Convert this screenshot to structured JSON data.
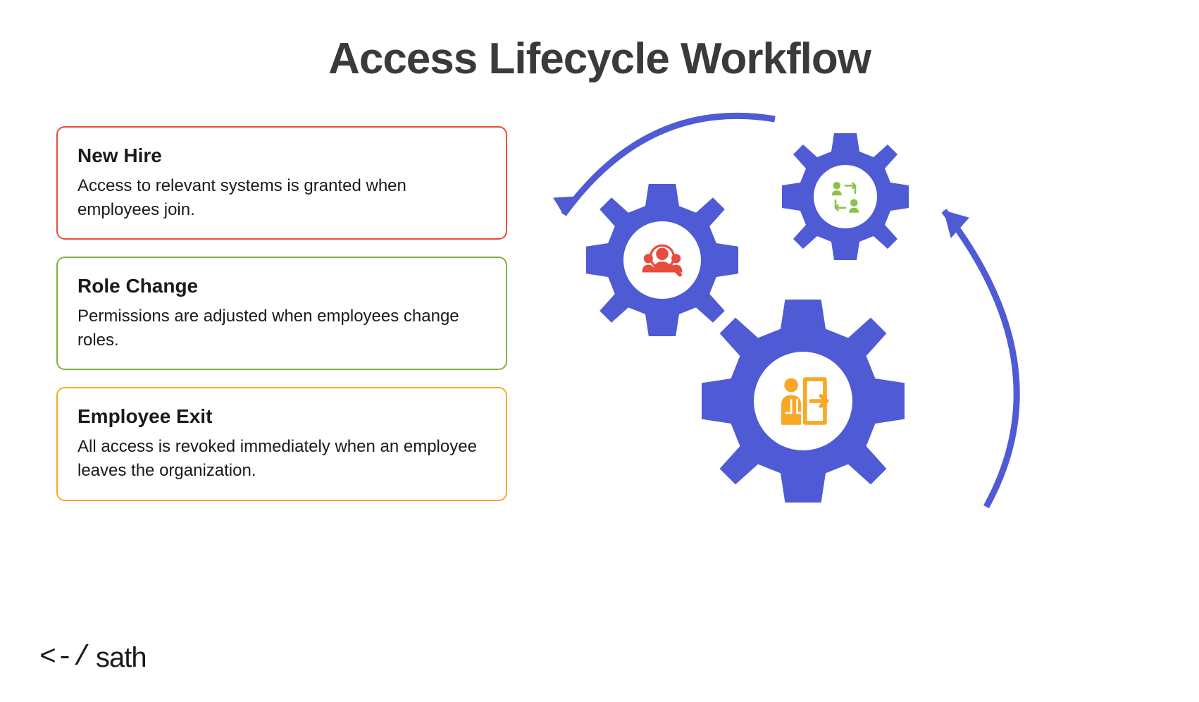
{
  "title": "Access Lifecycle Workflow",
  "cards": [
    {
      "title": "New Hire",
      "desc": "Access to relevant systems is granted when employees join.",
      "color": "#e94b3c"
    },
    {
      "title": "Role Change",
      "desc": "Permissions are adjusted when employees change roles.",
      "color": "#7cb342"
    },
    {
      "title": "Employee Exit",
      "desc": "All access is revoked immediately when an employee leaves the organization.",
      "color": "#f9a825"
    }
  ],
  "gears": [
    {
      "name": "new-hire-gear",
      "icon": "people-search-icon",
      "icon_color": "#e94b3c"
    },
    {
      "name": "role-change-gear",
      "icon": "people-swap-icon",
      "icon_color": "#7cb342"
    },
    {
      "name": "employee-exit-gear",
      "icon": "person-exit-icon",
      "icon_color": "#f9a825"
    }
  ],
  "gear_color": "#4f5bd5",
  "logo": {
    "mark": "<-/",
    "text": "sath"
  }
}
